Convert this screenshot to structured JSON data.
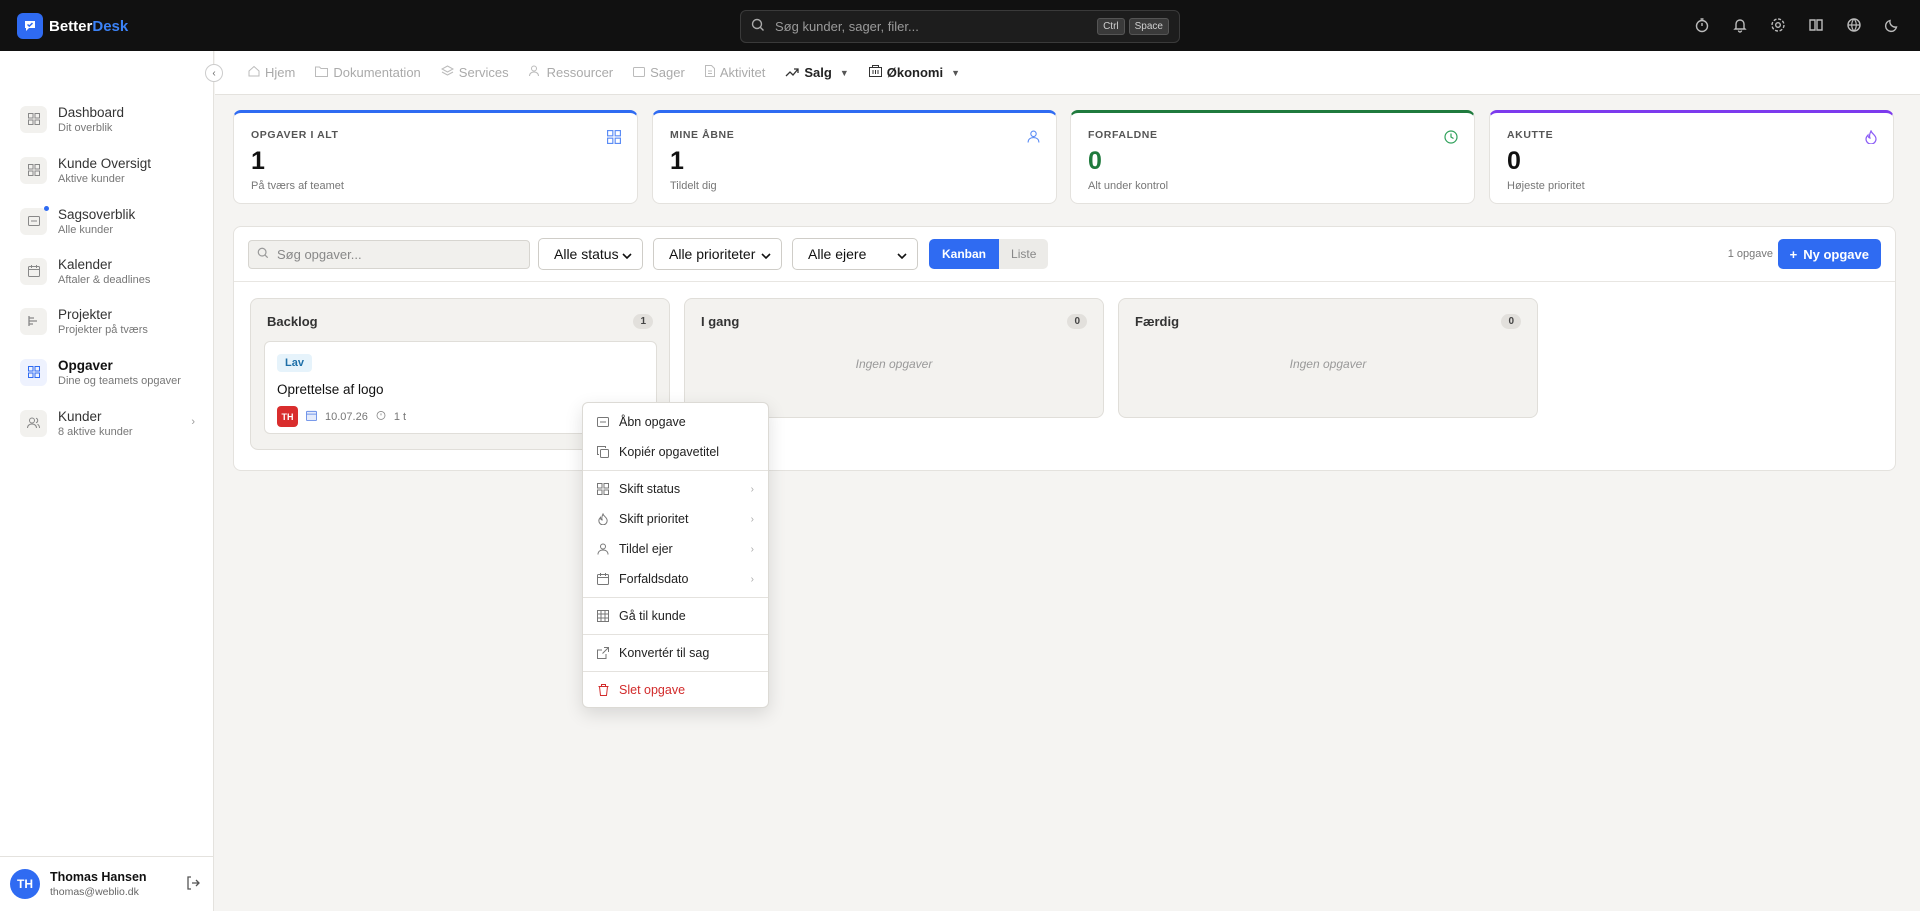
{
  "app": {
    "name_a": "Better",
    "name_b": "Desk"
  },
  "search": {
    "placeholder": "Søg kunder, sager, filer...",
    "key1": "Ctrl",
    "key2": "Space"
  },
  "sidebar": {
    "items": [
      {
        "title": "Dashboard",
        "sub": "Dit overblik"
      },
      {
        "title": "Kunde Oversigt",
        "sub": "Aktive kunder"
      },
      {
        "title": "Sagsoverblik",
        "sub": "Alle kunder"
      },
      {
        "title": "Kalender",
        "sub": "Aftaler & deadlines"
      },
      {
        "title": "Projekter",
        "sub": "Projekter på tværs"
      },
      {
        "title": "Opgaver",
        "sub": "Dine og teamets opgaver"
      },
      {
        "title": "Kunder",
        "sub": "8 aktive kunder"
      }
    ],
    "user": {
      "initials": "TH",
      "name": "Thomas Hansen",
      "email": "thomas@weblio.dk"
    }
  },
  "subnav": [
    "Hjem",
    "Dokumentation",
    "Services",
    "Ressourcer",
    "Sager",
    "Aktivitet",
    "Salg",
    "Økonomi"
  ],
  "stats": [
    {
      "label": "OPGAVER I ALT",
      "value": "1",
      "sub": "På tværs af teamet",
      "color": "#2f6bf2"
    },
    {
      "label": "MINE ÅBNE",
      "value": "1",
      "sub": "Tildelt dig",
      "color": "#2f6bf2"
    },
    {
      "label": "FORFALDNE",
      "value": "0",
      "sub": "Alt under kontrol",
      "color": "#1f7a3d"
    },
    {
      "label": "AKUTTE",
      "value": "0",
      "sub": "Højeste prioritet",
      "color": "#7c3aed"
    }
  ],
  "toolbar": {
    "search_placeholder": "Søg opgaver...",
    "status": "Alle status",
    "priority": "Alle prioriteter",
    "owner": "Alle ejere",
    "view_kanban": "Kanban",
    "view_list": "Liste",
    "count": "1 opgave",
    "new_task": "Ny opgave"
  },
  "columns": [
    {
      "title": "Backlog",
      "count": "1"
    },
    {
      "title": "I gang",
      "count": "0",
      "empty": "Ingen opgaver"
    },
    {
      "title": "Færdig",
      "count": "0",
      "empty": "Ingen opgaver"
    }
  ],
  "task": {
    "tag": "Lav",
    "title": "Oprettelse af logo",
    "owner": "TH",
    "date": "10.07.26",
    "time": "1 t"
  },
  "context_menu": {
    "open": "Åbn opgave",
    "copy": "Kopiér opgavetitel",
    "status": "Skift status",
    "priority": "Skift prioritet",
    "assign": "Tildel ejer",
    "due": "Forfaldsdato",
    "goto": "Gå til kunde",
    "convert": "Konvertér til sag",
    "delete": "Slet opgave"
  }
}
